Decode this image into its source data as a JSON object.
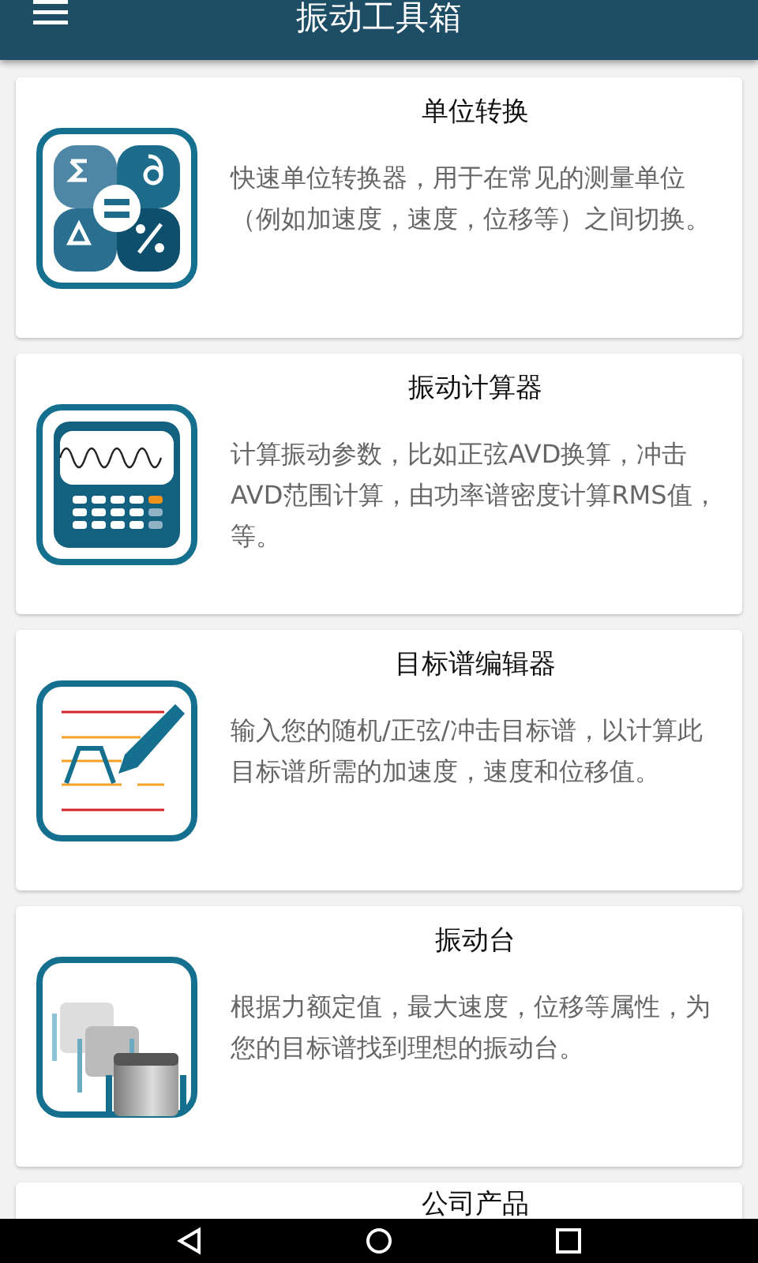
{
  "app_bar": {
    "title": "振动工具箱"
  },
  "cards": [
    {
      "kind": "units",
      "title": "单位转换",
      "description": "快速单位转换器，用于在常见的测量单位（例如加速度，速度，位移等）之间切换。"
    },
    {
      "kind": "calculator",
      "title": "振动计算器",
      "description": "计算振动参数，比如正弦AVD换算，冲击AVD范围计算，由功率谱密度计算RMS值，等。"
    },
    {
      "kind": "editor",
      "title": "目标谱编辑器",
      "description": "输入您的随机/正弦/冲击目标谱，以计算此目标谱所需的加速度，速度和位移值。"
    },
    {
      "kind": "shaker",
      "title": "振动台",
      "description": "根据力额定值，最大速度，位移等属性，为您的目标谱找到理想的振动台。"
    },
    {
      "kind": "partial",
      "title": "公司产品"
    }
  ]
}
